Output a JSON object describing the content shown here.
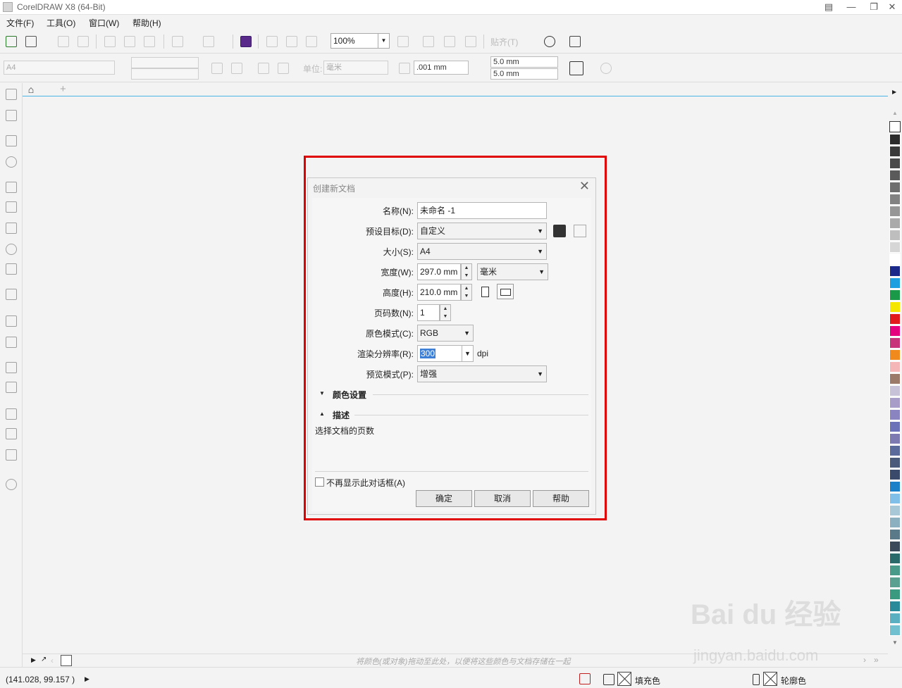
{
  "app": {
    "title": "CorelDRAW X8 (64-Bit)"
  },
  "menu": [
    {
      "label": "文件(F)"
    },
    {
      "label": "工具(O)"
    },
    {
      "label": "窗口(W)"
    },
    {
      "label": "帮助(H)"
    }
  ],
  "toolbar": {
    "zoom": "100%",
    "snap_label": "贴齐(T)"
  },
  "properties": {
    "page_size": "A4",
    "unit_label": "单位:",
    "unit_value": "毫米",
    "nudge": ".001 mm",
    "dup_x": "5.0 mm",
    "dup_y": "5.0 mm"
  },
  "palette_bar": {
    "hint": "将颜色(或对象)拖动至此处，以便将这些颜色与文档存储在一起"
  },
  "status": {
    "coords": "(141.028, 99.157 )",
    "fill_label": "填充色",
    "outline_label": "轮廓色"
  },
  "watermark": {
    "text": "Bai du 经验",
    "url": "jingyan.baidu.com"
  },
  "dialog": {
    "title": "创建新文档",
    "name_label": "名称(N):",
    "name_value": "未命名 -1",
    "preset_label": "预设目标(D):",
    "preset_value": "自定义",
    "size_label": "大小(S):",
    "size_value": "A4",
    "width_label": "宽度(W):",
    "width_value": "297.0 mm",
    "unit_value": "毫米",
    "height_label": "高度(H):",
    "height_value": "210.0 mm",
    "pages_label": "页码数(N):",
    "pages_value": "1",
    "color_mode_label": "原色模式(C):",
    "color_mode_value": "RGB",
    "resolution_label": "渲染分辨率(R):",
    "resolution_value": "300",
    "resolution_unit": "dpi",
    "preview_label": "预览模式(P):",
    "preview_value": "增强",
    "color_settings_label": "颜色设置",
    "description_label": "描述",
    "description_text": "选择文档的页数",
    "dont_show_label": "不再显示此对话框(A)",
    "ok_label": "确定",
    "cancel_label": "取消",
    "help_label": "帮助"
  },
  "colors": {
    "highlight": "#e00000",
    "tab_line": "#4bb4e6",
    "selection": "#3d7fd6",
    "palette": [
      "#2b2b2b",
      "#3a3a3a",
      "#4a4a4a",
      "#5a5a5a",
      "#6e6e6e",
      "#828282",
      "#969696",
      "#aaaaaa",
      "#bebebe",
      "#d6d6d6",
      "#ffffff",
      "#1b2a8a",
      "#1ea0e0",
      "#1a9a48",
      "#f5e600",
      "#e31a1c",
      "#e5007e",
      "#c8347a",
      "#f08a1c",
      "#f4b6b6",
      "#9c7a6a",
      "#c8c2d8",
      "#a89cc8",
      "#8a84c0",
      "#6c72b8",
      "#7c7ab0",
      "#5a6a9a",
      "#4a5a7a",
      "#3a4a6a",
      "#1c80c8",
      "#80c0e8",
      "#a8c8d8",
      "#8cb0c0",
      "#5a7a8a",
      "#3a4a5a",
      "#2a6a6a",
      "#4a9a8a",
      "#5aa090",
      "#3a9a80",
      "#2a8a9a",
      "#5ab0c0",
      "#70c0d0"
    ]
  }
}
